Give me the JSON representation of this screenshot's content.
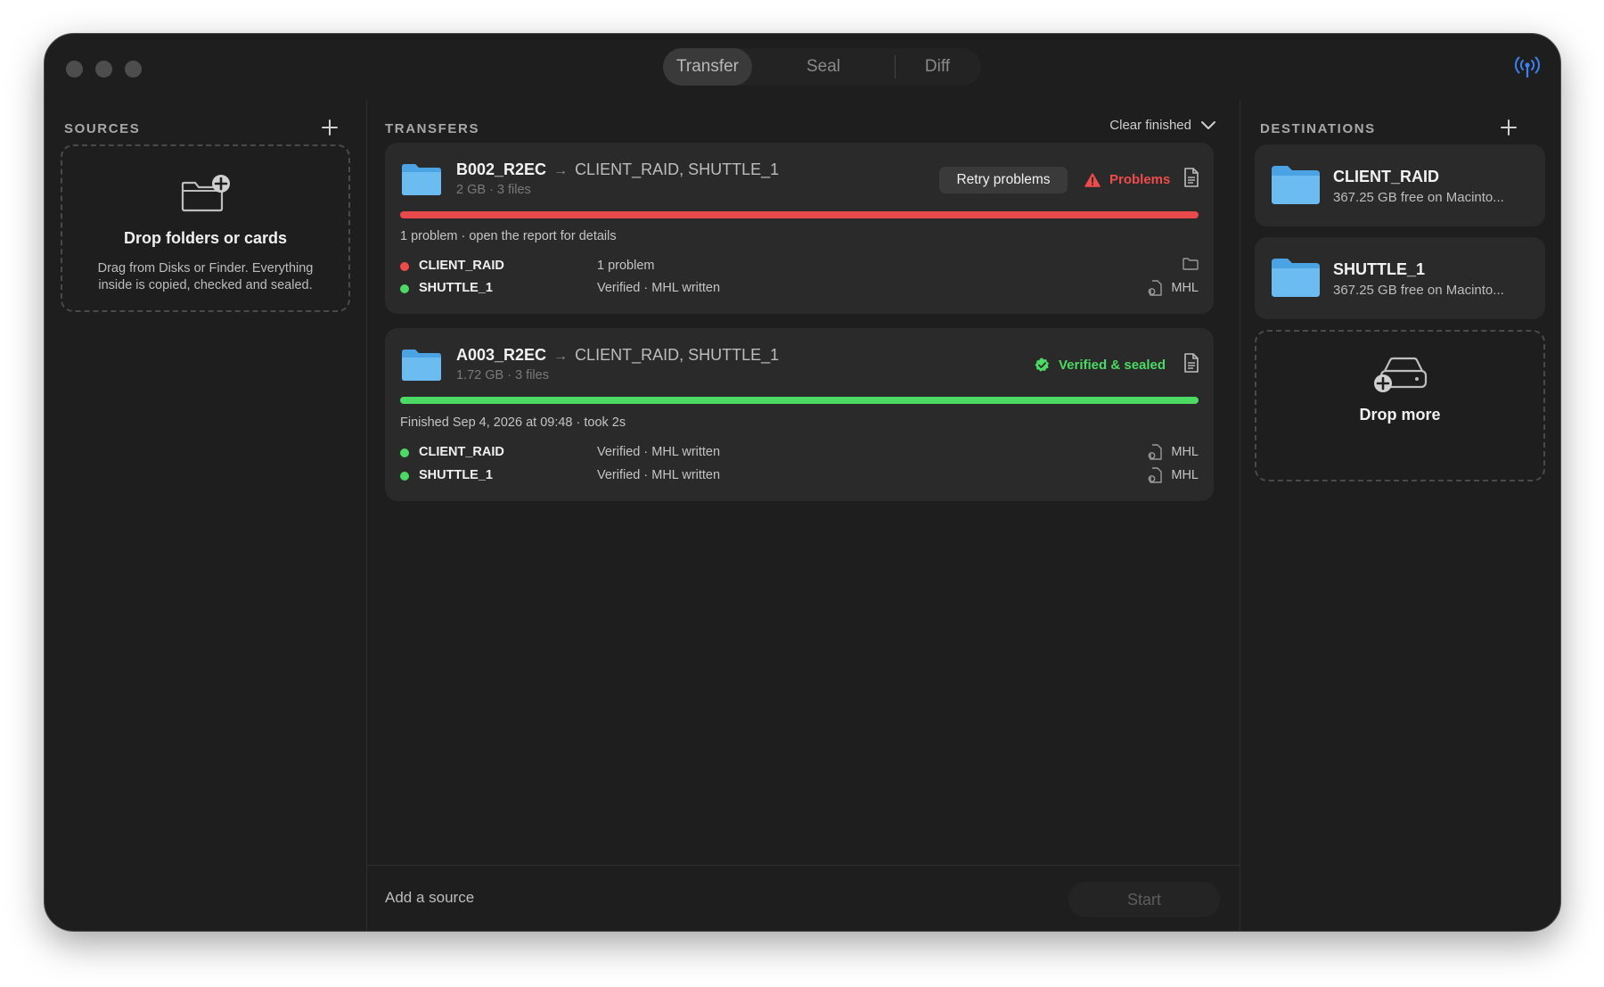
{
  "window": {
    "tabs": [
      {
        "label": "Transfer",
        "active": true
      },
      {
        "label": "Seal",
        "active": false
      },
      {
        "label": "Diff",
        "active": false
      }
    ],
    "status_icon": "antenna-icon",
    "accent_color": "#3b82f6"
  },
  "sources": {
    "title": "SOURCES",
    "drop_title": "Drop folders or cards",
    "drop_desc": "Drag from Disks or Finder. Everything inside is copied, checked and sealed."
  },
  "transfers": {
    "title": "TRANSFERS",
    "clear_label": "Clear finished",
    "items": [
      {
        "name": "B002_R2EC",
        "arrow": "→",
        "destinations": "CLIENT_RAID, SHUTTLE_1",
        "meta": "2 GB · 3 files",
        "retry_label": "Retry problems",
        "status_label": "Problems",
        "status_color": "#ef4b4b",
        "progress": 1.0,
        "progress_color": "#e8494b",
        "note": "1 problem · open the report for details",
        "rows": [
          {
            "name": "CLIENT_RAID",
            "status": "1 problem",
            "dot_color": "#ef4b4b",
            "right_icon": "folder-icon",
            "right_label": ""
          },
          {
            "name": "SHUTTLE_1",
            "status": "Verified · MHL written",
            "dot_color": "#4cd964",
            "right_icon": "document-seal-icon",
            "right_label": "MHL"
          }
        ]
      },
      {
        "name": "A003_R2EC",
        "arrow": "→",
        "destinations": "CLIENT_RAID, SHUTTLE_1",
        "meta": "1.72 GB · 3 files",
        "status_label": "Verified & sealed",
        "status_color": "#4cd964",
        "progress": 1.0,
        "progress_color": "#4cd964",
        "note": "Finished Sep 4, 2026 at 09:48 · took 2s",
        "rows": [
          {
            "name": "CLIENT_RAID",
            "status": "Verified · MHL written",
            "dot_color": "#4cd964",
            "right_icon": "document-seal-icon",
            "right_label": "MHL"
          },
          {
            "name": "SHUTTLE_1",
            "status": "Verified · MHL written",
            "dot_color": "#4cd964",
            "right_icon": "document-seal-icon",
            "right_label": "MHL"
          }
        ]
      }
    ],
    "footer_hint": "Add a source",
    "start_label": "Start"
  },
  "destinations": {
    "title": "DESTINATIONS",
    "items": [
      {
        "name": "CLIENT_RAID",
        "free": "367.25 GB free on Macinto..."
      },
      {
        "name": "SHUTTLE_1",
        "free": "367.25 GB free on Macinto..."
      }
    ],
    "drop_label": "Drop more"
  }
}
